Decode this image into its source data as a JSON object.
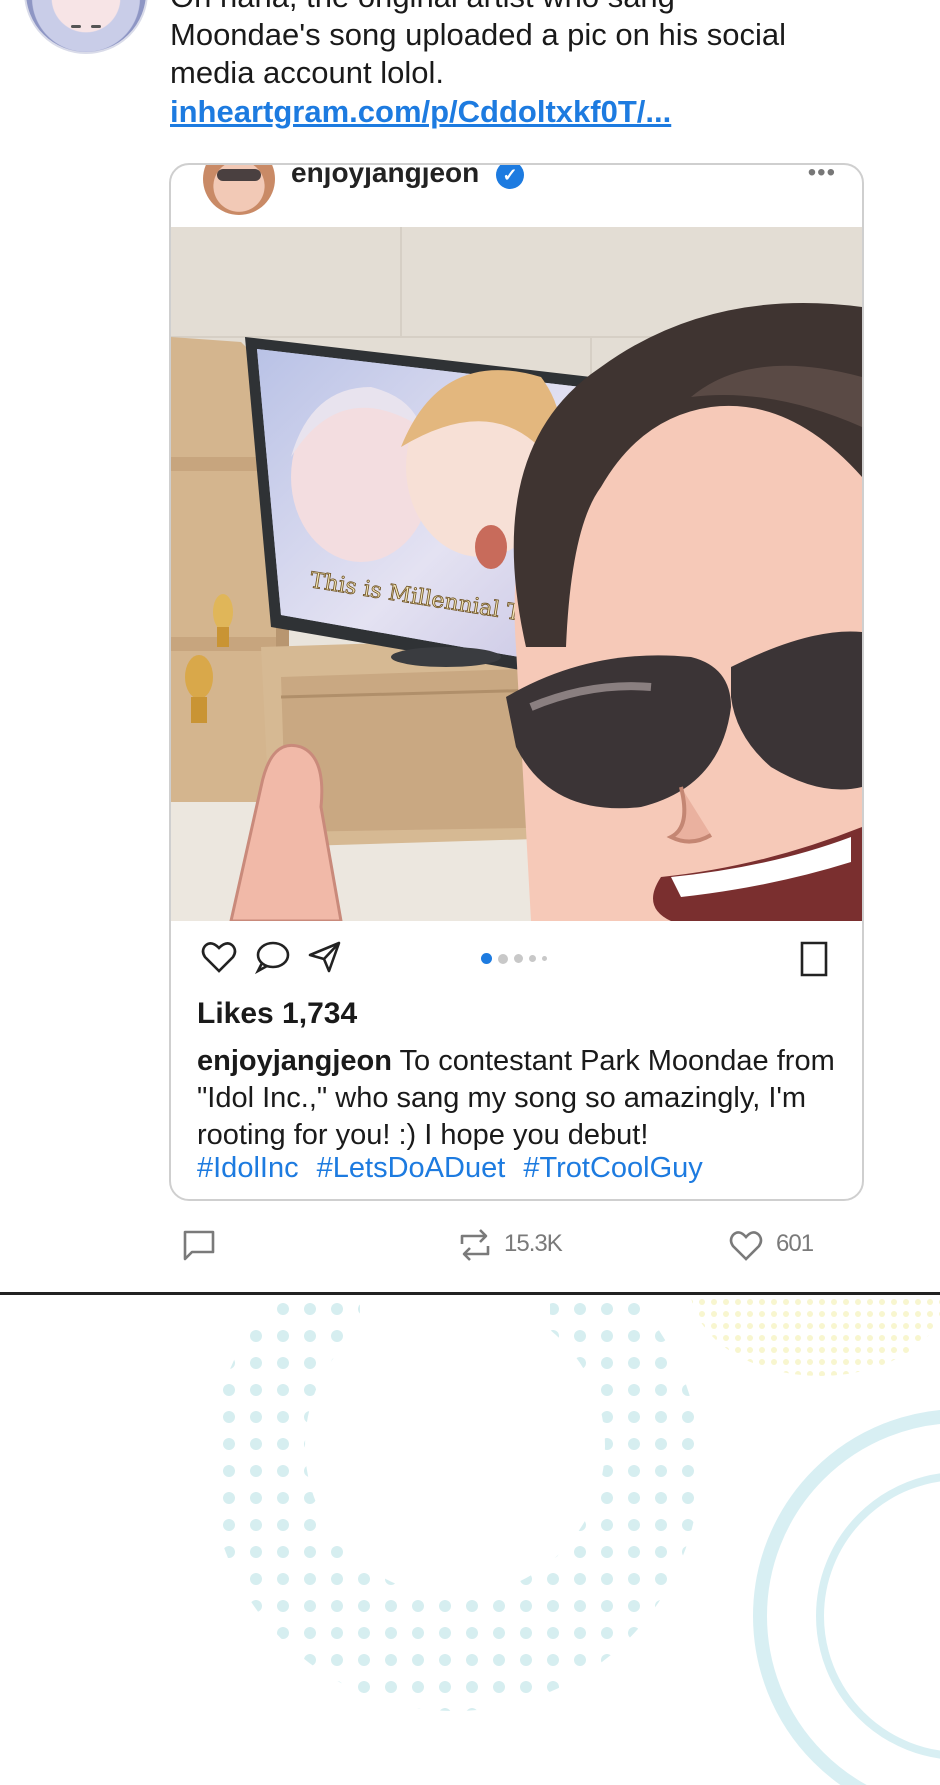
{
  "tweet": {
    "text_lines": [
      "Oh haha, the original artist who sang",
      "Moondae's song uploaded a pic on his social",
      "media account lolol."
    ],
    "link": "inheartgram.com/p/Cddoltxkf0T/..."
  },
  "post": {
    "username": "enjoyjangjeon",
    "likes_label": "Likes 1,734",
    "caption_user": "enjoyjangjeon",
    "caption_text": " To contestant Park Moondae from \"Idol Inc.,\" who sang my song so amazingly, I'm rooting for you! :) I hope you debut!",
    "hashtags": [
      "#IdolInc",
      "#LetsDoADuet",
      "#TrotCoolGuy"
    ],
    "image_text": "This is Millennial Trot",
    "carousel_active_index": 0,
    "carousel_count": 5
  },
  "footer": {
    "retweet_count": "15.3K",
    "like_count": "601"
  },
  "colors": {
    "link": "#1d7be0",
    "verified": "#1d7be0",
    "meta_gray": "#7a7a7a"
  }
}
